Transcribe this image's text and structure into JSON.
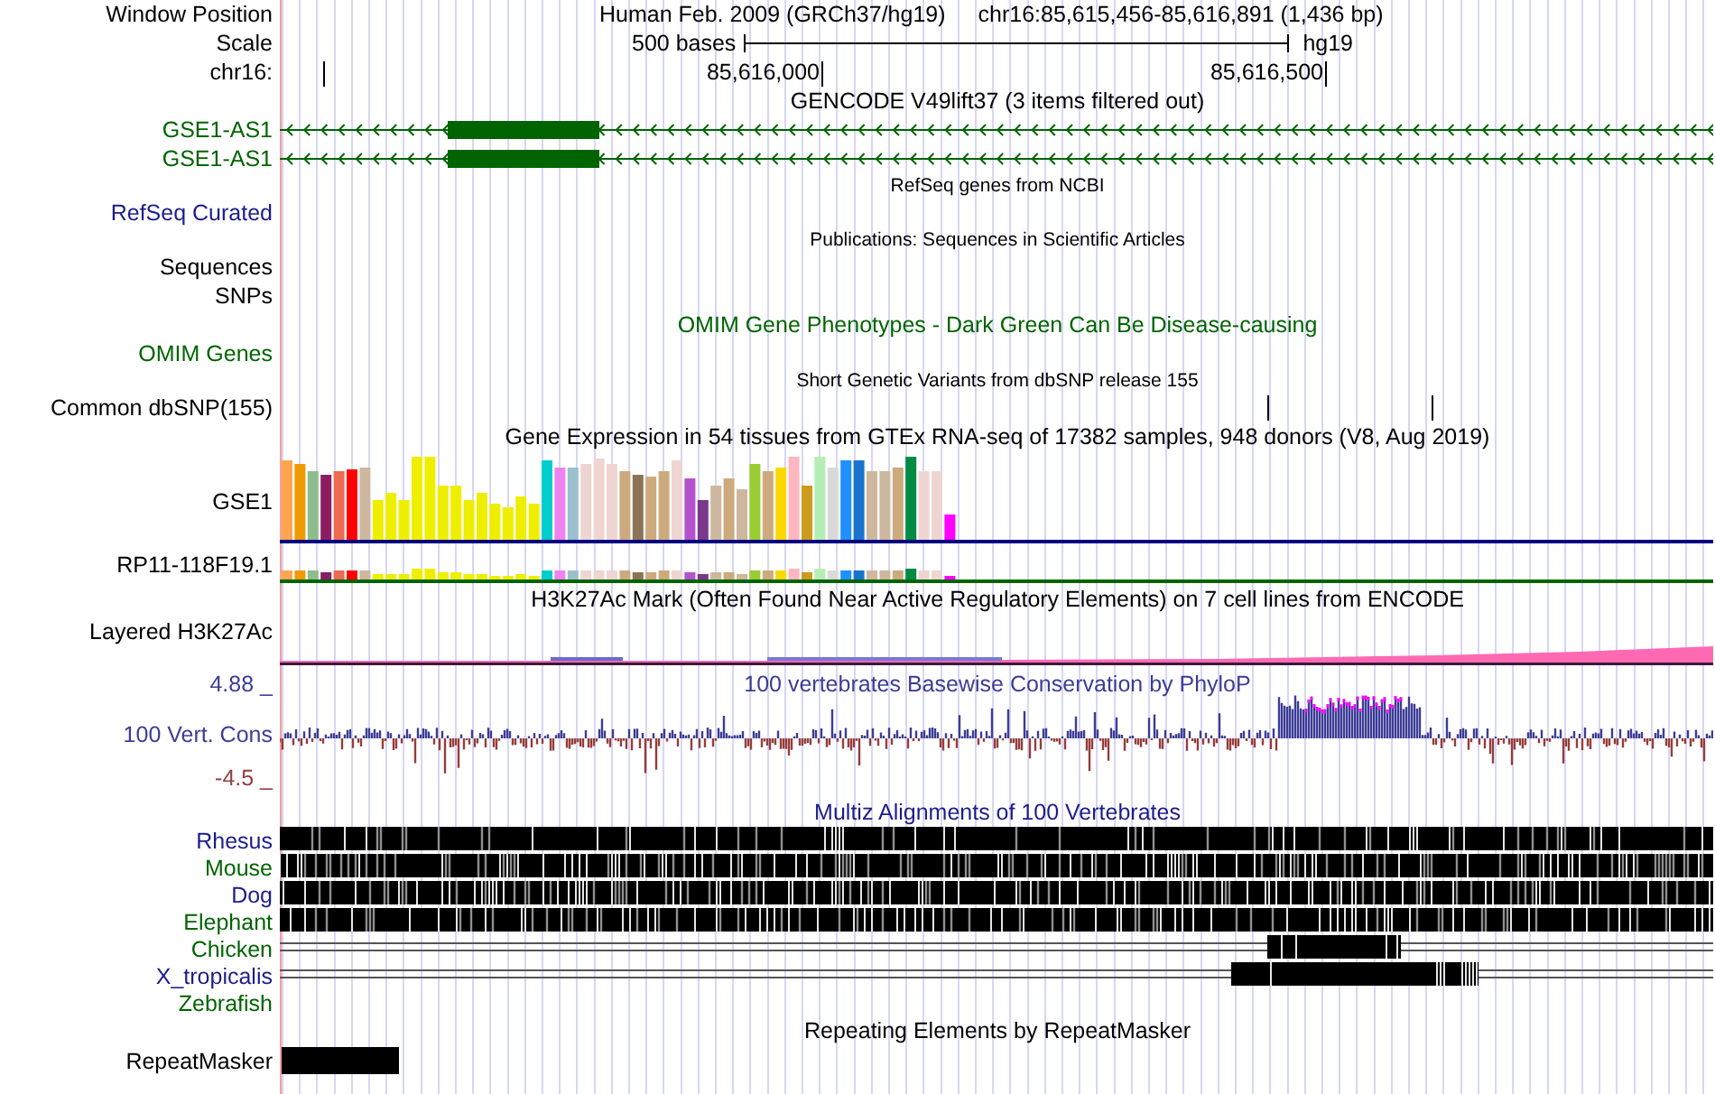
{
  "header": {
    "position_label": "Window Position",
    "assembly_text": "Human Feb. 2009 (GRCh37/hg19)",
    "position_text": "chr16:85,615,456-85,616,891 (1,436 bp)",
    "scale_label": "Scale",
    "scale_text": "500 bases",
    "assembly": "hg19",
    "chrom_label": "chr16:",
    "ticks": [
      "85,616,000",
      "85,616,500"
    ]
  },
  "tracks": [
    {
      "kind": "standard",
      "title": "GENCODE V49lift37 (3 items filtered out)",
      "color": "#000000",
      "rows": [
        {
          "kind": "gene",
          "label": "GSE1-AS1",
          "color": "#006400"
        },
        {
          "kind": "gene",
          "label": "GSE1-AS1",
          "color": "#006400"
        }
      ]
    },
    {
      "kind": "compact",
      "title": "RefSeq genes from NCBI",
      "color": "#000000",
      "rows": [
        {
          "kind": "empty",
          "label": "RefSeq Curated",
          "color": "#1c1c8c"
        }
      ]
    },
    {
      "kind": "compact",
      "title": "Publications: Sequences in Scientific Articles",
      "color": "#000000",
      "rows": [
        {
          "kind": "empty",
          "label": "Sequences",
          "color": "#000000"
        },
        {
          "kind": "empty",
          "label": "SNPs",
          "color": "#000000"
        }
      ]
    },
    {
      "kind": "standard",
      "title": "OMIM Gene Phenotypes - Dark Green Can Be Disease-causing",
      "color": "#006400",
      "rows": [
        {
          "kind": "empty",
          "label": "OMIM Genes",
          "color": "#006400"
        }
      ]
    },
    {
      "kind": "compact",
      "title": "Short Genetic Variants from dbSNP release 155",
      "color": "#000000",
      "rows": [
        {
          "kind": "snp",
          "label": "Common dbSNP(155)",
          "color": "#000000"
        }
      ]
    },
    {
      "kind": "standard",
      "title": "Gene Expression in 54 tissues from GTEx RNA-seq of 17382 samples, 948 donors (V8, Aug 2019)",
      "color": "#000000",
      "rows": [
        {
          "kind": "expression",
          "label": "GSE1",
          "color": "#000000"
        },
        {
          "kind": "expression_small",
          "label": "RP11-118F19.1",
          "color": "#000000"
        }
      ]
    },
    {
      "kind": "standard",
      "title": "H3K27Ac Mark (Often Found Near Active Regulatory Elements) on 7 cell lines from ENCODE",
      "color": "#000000",
      "rows": [
        {
          "kind": "signal",
          "label": "Layered H3K27Ac",
          "color": "#000000"
        }
      ]
    },
    {
      "kind": "inline",
      "title": "100 vertebrates Basewise Conservation by PhyloP",
      "color": "#3c3c96",
      "rows": [
        {
          "kind": "conservation",
          "label": "100 Vert. Cons",
          "color": "#3c3c96",
          "axis_top": "4.88 _",
          "axis_bottom": "-4.5 _"
        }
      ]
    },
    {
      "kind": "standard",
      "title": "Multiz Alignments of 100 Vertebrates",
      "color": "#1c1c8c",
      "rows": [
        {
          "kind": "alignment",
          "label": "Rhesus",
          "color": "#1c1c8c"
        },
        {
          "kind": "alignment",
          "label": "Mouse",
          "color": "#006400"
        },
        {
          "kind": "alignment",
          "label": "Dog",
          "color": "#1c1c8c"
        },
        {
          "kind": "alignment",
          "label": "Elephant",
          "color": "#006400"
        },
        {
          "kind": "sparse_alignment",
          "label": "Chicken",
          "color": "#006400"
        },
        {
          "kind": "sparse_alignment",
          "label": "X_tropicalis",
          "color": "#1c1c8c"
        },
        {
          "kind": "empty_alignment",
          "label": "Zebrafish",
          "color": "#006400"
        }
      ]
    },
    {
      "kind": "standard",
      "title": "Repeating Elements by RepeatMasker",
      "color": "#000000",
      "rows": [
        {
          "kind": "repeat",
          "label": "RepeatMasker",
          "color": "#000000"
        }
      ]
    }
  ]
}
